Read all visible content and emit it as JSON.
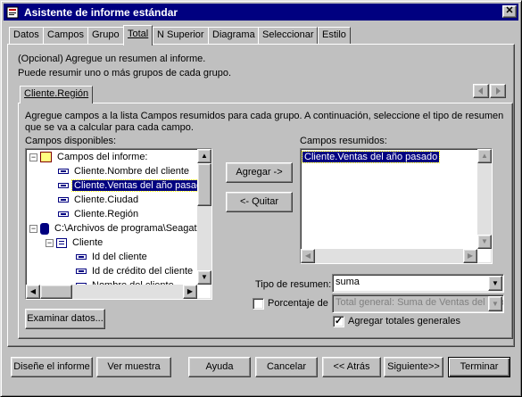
{
  "window": {
    "title": "Asistente de informe estándar",
    "close_glyph": "✕"
  },
  "tabs": [
    {
      "label": "Datos"
    },
    {
      "label": "Campos"
    },
    {
      "label": "Grupo"
    },
    {
      "label": "Total"
    },
    {
      "label": "N Superior"
    },
    {
      "label": "Diagrama"
    },
    {
      "label": "Seleccionar"
    },
    {
      "label": "Estilo"
    }
  ],
  "active_tab": "Total",
  "intro": {
    "line1": "(Opcional) Agregue un resumen al informe.",
    "line2": "Puede resumir uno o más grupos de cada grupo."
  },
  "group_tab": {
    "label": "Cliente.Región"
  },
  "instructions": {
    "line1": "Agregue campos a la lista Campos resumidos para cada grupo. A continuación, seleccione el tipo de resumen",
    "line2": "que se va a calcular para cada campo."
  },
  "available": {
    "label": "Campos disponibles:",
    "items": [
      {
        "text": "Campos del informe:",
        "expander": "−",
        "icon": "report"
      },
      {
        "text": "Cliente.Nombre del cliente",
        "icon": "field"
      },
      {
        "text": "Cliente.Ventas del año pasado",
        "icon": "field",
        "selected": true
      },
      {
        "text": "Cliente.Ciudad",
        "icon": "field"
      },
      {
        "text": "Cliente.Región",
        "icon": "field"
      },
      {
        "text": "C:\\Archivos de programa\\Seagate",
        "expander": "−",
        "icon": "db"
      },
      {
        "text": "Cliente",
        "expander": "−",
        "icon": "table"
      },
      {
        "text": "Id del cliente",
        "icon": "field"
      },
      {
        "text": "Id de crédito del cliente",
        "icon": "field"
      },
      {
        "text": "Nombre del cliente",
        "icon": "field"
      }
    ]
  },
  "buttons": {
    "add": "Agregar ->",
    "remove": "<- Quitar",
    "browse": "Examinar datos..."
  },
  "summarized": {
    "label": "Campos resumidos:",
    "items": [
      {
        "text": "Cliente.Ventas del año pasado",
        "selected": true
      }
    ]
  },
  "summary_type": {
    "label": "Tipo de resumen:",
    "value": "suma"
  },
  "percentage": {
    "label": "Porcentaje de",
    "checked": false,
    "value": "Total general: Suma de Ventas del año pasado"
  },
  "grand_totals": {
    "label": "Agregar totales generales",
    "checked": true
  },
  "footer": {
    "design": "Diseñe el informe",
    "preview": "Ver muestra",
    "help": "Ayuda",
    "cancel": "Cancelar",
    "back": "<< Atrás",
    "next": "Siguiente>>",
    "finish": "Terminar"
  }
}
